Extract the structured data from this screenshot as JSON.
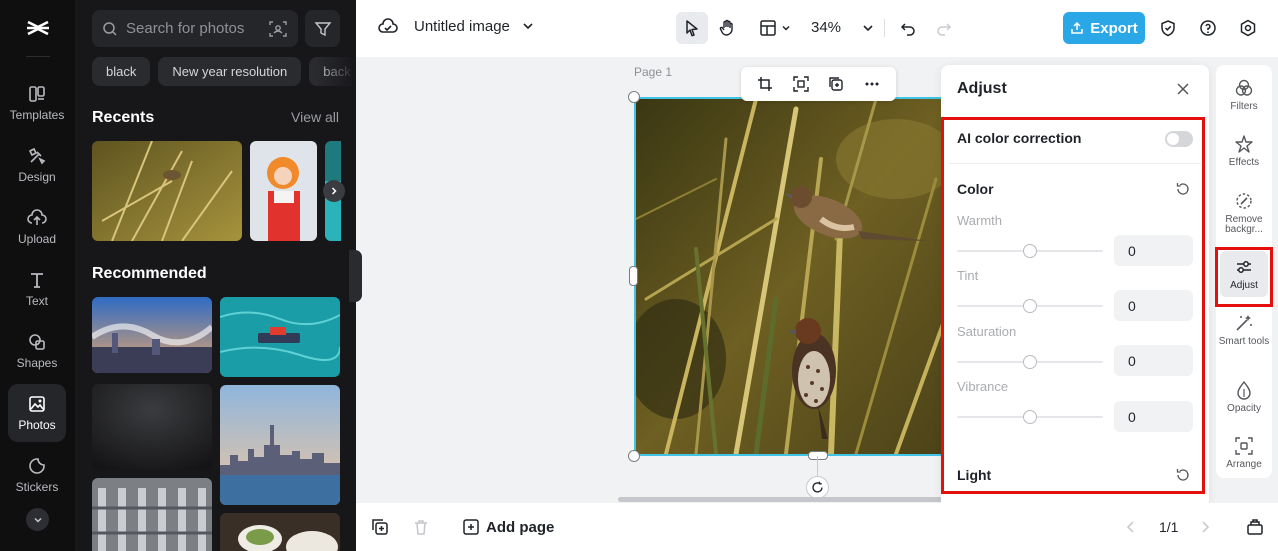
{
  "nav": {
    "items": [
      {
        "label": "Templates",
        "icon": "templates-icon"
      },
      {
        "label": "Design",
        "icon": "design-icon"
      },
      {
        "label": "Upload",
        "icon": "upload-icon"
      },
      {
        "label": "Text",
        "icon": "text-icon"
      },
      {
        "label": "Shapes",
        "icon": "shapes-icon"
      },
      {
        "label": "Photos",
        "icon": "photos-icon",
        "active": true
      },
      {
        "label": "Stickers",
        "icon": "stickers-icon"
      }
    ]
  },
  "photos_panel": {
    "search_placeholder": "Search for photos",
    "chips": [
      "black",
      "New year resolution",
      "back"
    ],
    "recents_title": "Recents",
    "view_all": "View all",
    "recommended_title": "Recommended"
  },
  "header": {
    "doc_title": "Untitled image",
    "zoom": "34%",
    "export_label": "Export"
  },
  "canvas": {
    "page_label": "Page 1"
  },
  "adjust": {
    "title": "Adjust",
    "ai_label": "AI color correction",
    "ai_enabled": false,
    "color_title": "Color",
    "warmth_label": "Warmth",
    "warmth_value": "0",
    "tint_label": "Tint",
    "tint_value": "0",
    "saturation_label": "Saturation",
    "saturation_value": "0",
    "vibrance_label": "Vibrance",
    "vibrance_value": "0",
    "light_title": "Light"
  },
  "tools": {
    "filters": "Filters",
    "effects": "Effects",
    "remove_bg": "Remove backgr...",
    "adjust": "Adjust",
    "smart_tools": "Smart tools",
    "opacity": "Opacity",
    "arrange": "Arrange"
  },
  "footer": {
    "add_page": "Add page",
    "pager": "1/1"
  },
  "colors": {
    "accent": "#2aa7e6",
    "highlight": "#e3100e",
    "selection": "#3fc4e8"
  }
}
